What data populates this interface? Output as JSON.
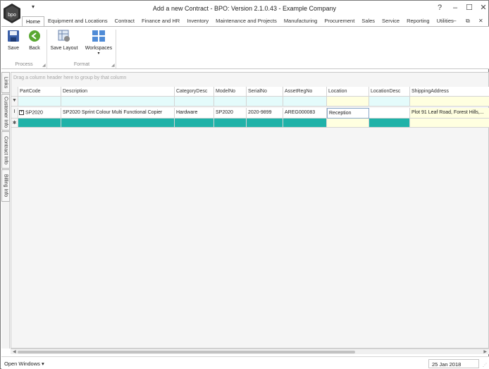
{
  "window": {
    "title": "Add a new Contract - BPO: Version 2.1.0.43 - Example Company",
    "logo_text": "bpo"
  },
  "ribbon": {
    "tabs": [
      {
        "label": "Home",
        "active": true
      },
      {
        "label": "Equipment and Locations"
      },
      {
        "label": "Contract"
      },
      {
        "label": "Finance and HR"
      },
      {
        "label": "Inventory"
      },
      {
        "label": "Maintenance and Projects"
      },
      {
        "label": "Manufacturing"
      },
      {
        "label": "Procurement"
      },
      {
        "label": "Sales"
      },
      {
        "label": "Service"
      },
      {
        "label": "Reporting"
      },
      {
        "label": "Utilities"
      }
    ],
    "buttons": {
      "save": "Save",
      "back": "Back",
      "save_layout": "Save Layout",
      "workspaces": "Workspaces"
    },
    "groups": {
      "process": "Process",
      "format": "Format"
    }
  },
  "side_tabs": [
    "Links",
    "Customer Info",
    "Contract Info",
    "Billing Info"
  ],
  "grid": {
    "group_panel_hint": "Drag a column header here to group by that column",
    "columns": [
      "PartCode",
      "Description",
      "CategoryDesc",
      "ModelNo",
      "SerialNo",
      "AssetRegNo",
      "Location",
      "LocationDesc",
      "ShippingAddress"
    ],
    "rows": [
      {
        "PartCode": "SP2020",
        "Description": "SP2020 Sprint Colour Multi Functional Copier",
        "CategoryDesc": "Hardware",
        "ModelNo": "SP2020",
        "SerialNo": "2020-9899",
        "AssetRegNo": "AREG000083",
        "Location": "Reception",
        "LocationDesc": "",
        "ShippingAddress": "Plot 91 Leaf Road, Forest Hills,..."
      }
    ],
    "filter_indicator": "▼",
    "edit_indicator": "I",
    "new_row_indicator": "✱"
  },
  "status": {
    "open_windows": "Open Windows",
    "date": "25 Jan 2018"
  },
  "colors": {
    "new_row": "#1fb2a8",
    "filter_row": "#e4fbfb",
    "edit_cell": "#ffffe0"
  }
}
